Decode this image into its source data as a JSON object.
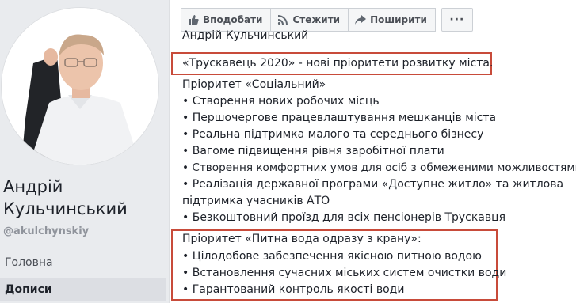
{
  "profile": {
    "name": "Андрій Кульчинський",
    "handle": "@akulchynskiy",
    "nav": [
      "Головна",
      "Дописи"
    ]
  },
  "actions": {
    "like": "Вподобати",
    "follow": "Стежити",
    "share": "Поширити",
    "more": "···"
  },
  "post": {
    "clipped_line": "Андрій Кульчинський",
    "lines": [
      "«Трускавець 2020» - нові пріоритети розвитку міста.",
      "Пріоритет «Соціальний»",
      "• Створення нових робочих місць",
      "• Першочергове працевлаштування мешканців міста",
      "• Реальна підтримка малого та середнього бізнесу",
      "• Вагоме підвищення рівня заробітної плати",
      "• Створення комфортних умов для осіб з обмеженими можливостями",
      "• Реалізація державної програми «Доступне житло» та житлова",
      "підтримка учасників АТО",
      "• Безкоштовний проїзд для всіх пенсіонерів Трускавця",
      "Пріоритет «Питна вода одразу з крану»:",
      "• Цілодобове забезпечення якісною питною водою",
      "• Встановлення сучасних міських систем очистки води",
      "• Гарантований контроль якості води"
    ]
  },
  "colors": {
    "highlight_box": "#c84b3a",
    "page_bg": "#e9ebee"
  }
}
